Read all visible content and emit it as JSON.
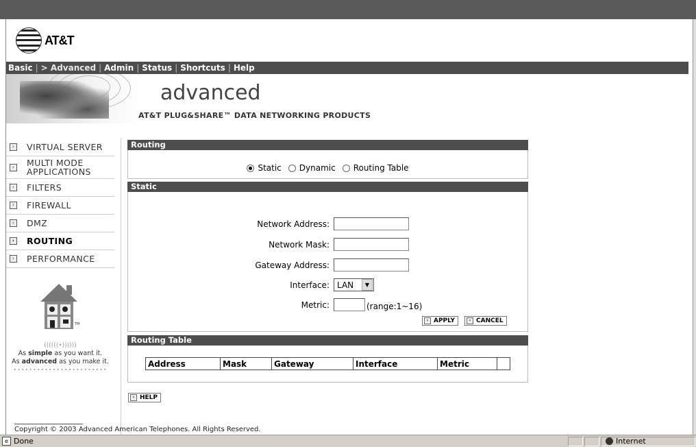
{
  "logo": {
    "text": "AT&T"
  },
  "nav": {
    "basic": "Basic",
    "advanced": "> Advanced",
    "admin": "Admin",
    "status": "Status",
    "shortcuts": "Shortcuts",
    "help": "Help"
  },
  "banner": {
    "title": "advanced",
    "subtitle": "AT&T PLUG&SHARE™ DATA NETWORKING PRODUCTS"
  },
  "sidebar": {
    "items": [
      {
        "label": "VIRTUAL SERVER"
      },
      {
        "label": "MULTI MODE APPLICATIONS"
      },
      {
        "label": "FILTERS"
      },
      {
        "label": "FIREWALL"
      },
      {
        "label": "DMZ"
      },
      {
        "label": "ROUTING",
        "active": true
      },
      {
        "label": "PERFORMANCE"
      }
    ],
    "tagline": {
      "waves": "((((((•))))))",
      "line1_pre": "As ",
      "line1_em": "simple",
      "line1_post": " as you want it.",
      "line2_pre": "As ",
      "line2_em": "advanced",
      "line2_post": " as you make it.",
      "tm": "TM"
    }
  },
  "routing": {
    "header": "Routing",
    "options": [
      {
        "label": "Static",
        "selected": true
      },
      {
        "label": "Dynamic",
        "selected": false
      },
      {
        "label": "Routing Table",
        "selected": false
      }
    ]
  },
  "static": {
    "header": "Static",
    "network_address_label": "Network Address:",
    "network_address_value": "",
    "network_mask_label": "Network Mask:",
    "network_mask_value": "",
    "gateway_address_label": "Gateway Address:",
    "gateway_address_value": "",
    "interface_label": "Interface:",
    "interface_value": "LAN",
    "metric_label": "Metric:",
    "metric_value": "",
    "metric_range": "(range:1~16)",
    "apply": "APPLY",
    "cancel": "CANCEL"
  },
  "routing_table": {
    "header": "Routing Table",
    "columns": [
      "Address",
      "Mask",
      "Gateway",
      "Interface",
      "Metric"
    ]
  },
  "help_button": "HELP",
  "copyright": "Copyright © 2003 Advanced American Telephones. All Rights Reserved.",
  "statusbar": {
    "left": "Done",
    "zone": "Internet"
  }
}
